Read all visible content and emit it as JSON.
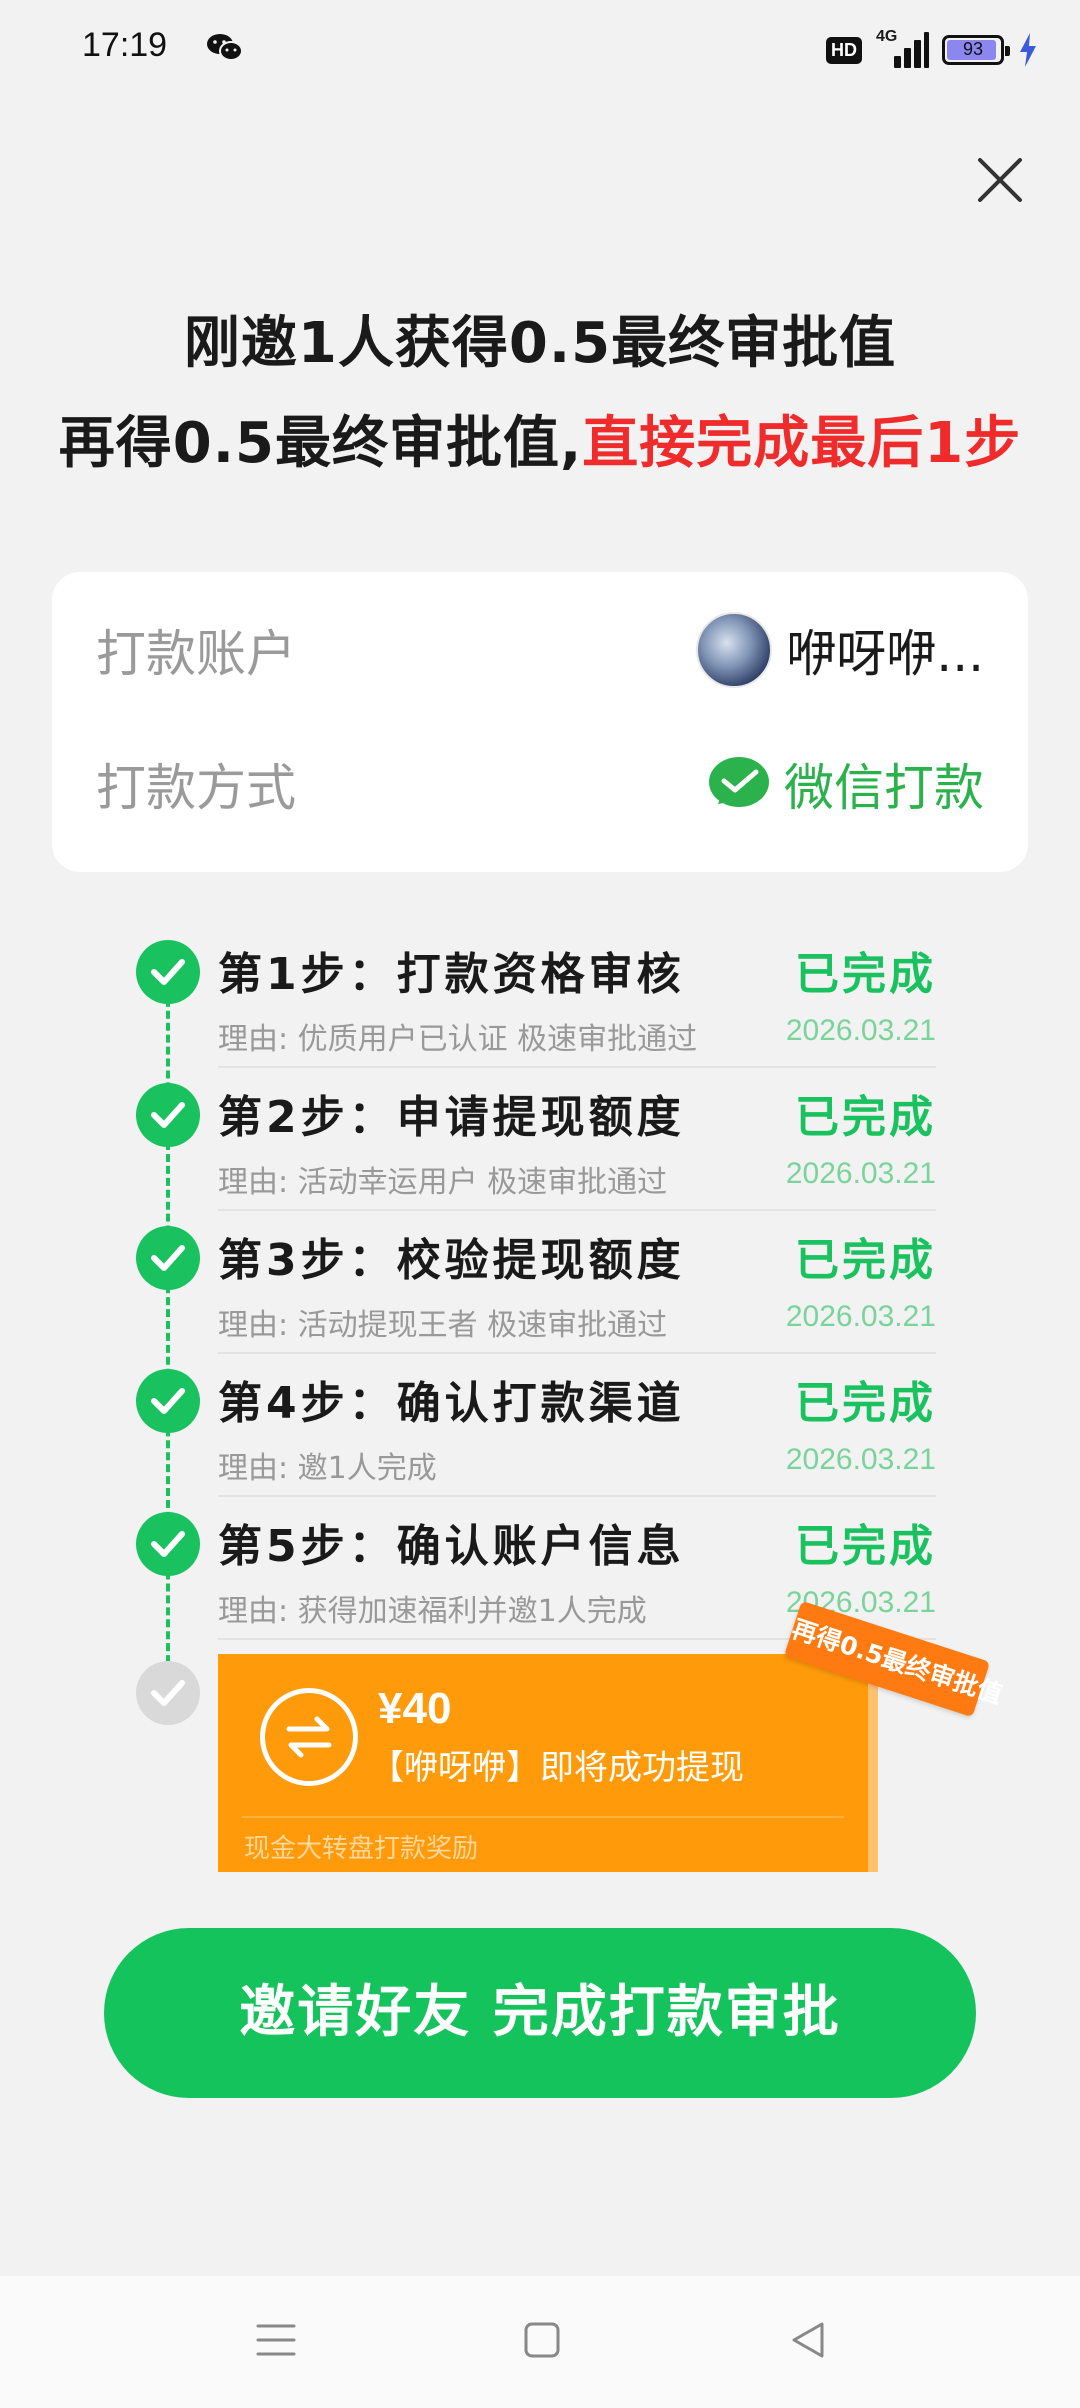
{
  "status_bar": {
    "time": "17:19",
    "network_badge": "HD",
    "signal_label": "4G",
    "battery": "93",
    "battery_level": 0.93
  },
  "header": {
    "line1": "刚邀1人获得0.5最终审批值",
    "line2_plain": "再得0.5最终审批值,",
    "line2_highlight": "直接完成最后1步"
  },
  "account_card": {
    "account_label": "打款账户",
    "account_value": "咿呀咿...",
    "method_label": "打款方式",
    "method_value": "微信打款"
  },
  "steps": [
    {
      "title": "第1步：打款资格审核",
      "status": "已完成",
      "reason": "理由: 优质用户已认证 极速审批通过",
      "date": "2026.03.21"
    },
    {
      "title": "第2步：申请提现额度",
      "status": "已完成",
      "reason": "理由: 活动幸运用户 极速审批通过",
      "date": "2026.03.21"
    },
    {
      "title": "第3步：校验提现额度",
      "status": "已完成",
      "reason": "理由: 活动提现王者 极速审批通过",
      "date": "2026.03.21"
    },
    {
      "title": "第4步：确认打款渠道",
      "status": "已完成",
      "reason": "理由: 邀1人完成",
      "date": "2026.03.21"
    },
    {
      "title": "第5步：确认账户信息",
      "status": "已完成",
      "reason": "理由: 获得加速福利并邀1人完成",
      "date": "2026.03.21"
    }
  ],
  "prize": {
    "amount": "¥40",
    "message": "【咿呀咿】即将成功提现",
    "footer": "现金大转盘打款奖励",
    "ribbon": "再得0.5最终审批值"
  },
  "invite_button": "邀请好友 完成打款审批",
  "colors": {
    "green": "#19c25e",
    "red": "#ef2b2b",
    "orange": "#ff9a0a"
  },
  "icons": [
    "wechat-icon",
    "close-icon",
    "check-icon",
    "exchange-icon",
    "menu-icon",
    "home-icon",
    "back-icon"
  ]
}
